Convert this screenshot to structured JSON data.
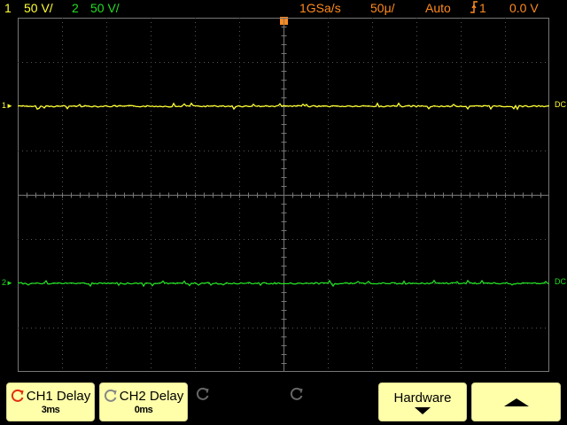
{
  "status_bar": {
    "ch1_number": "1",
    "ch1_scale": "50 V/",
    "ch2_number": "2",
    "ch2_scale": "50 V/",
    "sample_rate": "1GSa/s",
    "timebase": "50μ/",
    "trigger_mode": "Auto",
    "trigger_source": "1",
    "trigger_level": "0.0 V"
  },
  "channel_markers": {
    "ch1_left": "1",
    "ch2_left": "2",
    "ch1_right": "DC",
    "ch2_right": "DC"
  },
  "softkeys": {
    "ch1_delay_label": "CH1 Delay",
    "ch1_delay_value": "3ms",
    "ch2_delay_label": "CH2 Delay",
    "ch2_delay_value": "0ms",
    "hardware_label": "Hardware"
  },
  "icons": [
    "entry-knob-icon",
    "trigger-edge-icon",
    "trigger-position-icon",
    "down-arrow-icon",
    "up-arrow-icon"
  ],
  "colors": {
    "ch1": "#ffff33",
    "ch2": "#22dd22",
    "trigger": "#ff8a1e",
    "softkey_bg": "#ffffaa",
    "grid": "#555555"
  }
}
